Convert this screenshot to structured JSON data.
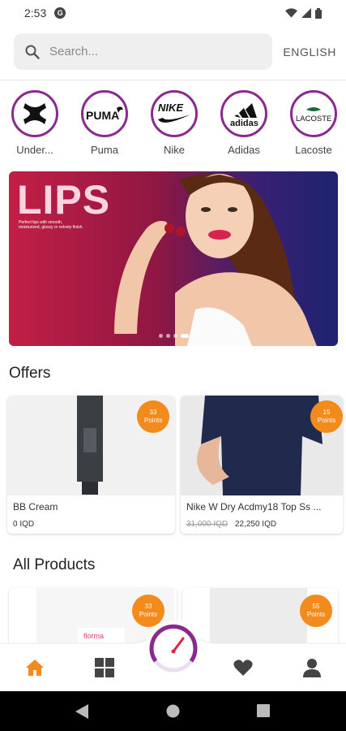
{
  "status_bar": {
    "time": "2:53",
    "notification_icon": "G"
  },
  "search": {
    "placeholder": "Search..."
  },
  "language": {
    "label": "ENGLISH"
  },
  "brands": [
    {
      "name": "Under...",
      "logo_text": "UNDER ARMOUR"
    },
    {
      "name": "Puma",
      "logo_text": "PUMA"
    },
    {
      "name": "Nike",
      "logo_text": "NIKE"
    },
    {
      "name": "Adidas",
      "logo_text": "adidas"
    },
    {
      "name": "Lacoste",
      "logo_text": "LACOSTE"
    }
  ],
  "banner": {
    "title": "LIPS",
    "subtitle": "Perfect lips with smooth, moisturized, glossy or velvety finish."
  },
  "offers": {
    "title": "Offers",
    "items": [
      {
        "name": "BB Cream",
        "old_price": "",
        "price": "0 IQD",
        "points_value": "33",
        "points_label": "Points"
      },
      {
        "name": "Nike W Dry Acdmy18 Top Ss ...",
        "old_price": "31,000 IQD",
        "price": "22,250 IQD",
        "points_value": "15",
        "points_label": "Points"
      }
    ]
  },
  "all_products": {
    "title": "All Products",
    "items": [
      {
        "points_value": "33",
        "points_label": "Points",
        "product_text": "florma"
      },
      {
        "points_value": "55",
        "points_label": "Points"
      }
    ]
  },
  "bottom_nav": {
    "active_color": "#f28a1c",
    "items": [
      "home-icon",
      "grid-icon",
      "gauge-icon",
      "heart-icon",
      "profile-icon"
    ]
  },
  "colors": {
    "accent": "#f28a1c",
    "brand_ring": "#8a2a8f"
  }
}
